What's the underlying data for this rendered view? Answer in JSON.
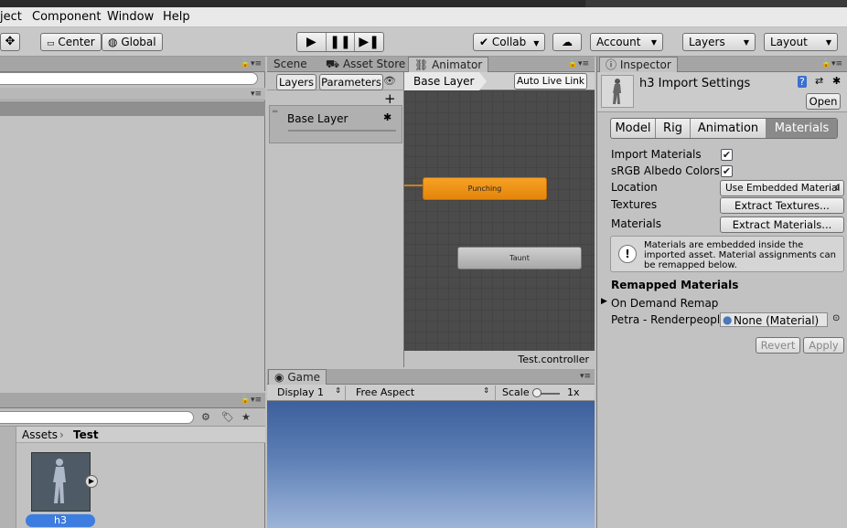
{
  "menu": [
    "ject",
    "Component",
    "Window",
    "Help"
  ],
  "toolbar": {
    "center": "Center",
    "global": "Global",
    "collab": "Collab",
    "account": "Account",
    "layers": "Layers",
    "layout": "Layout"
  },
  "tabs_center": [
    "Scene",
    "Asset Store",
    "Animator"
  ],
  "animator": {
    "sub_tabs": [
      "Layers",
      "Parameters"
    ],
    "breadcrumb": "Base Layer",
    "auto_live_link": "Auto Live Link",
    "layer_name": "Base Layer",
    "states": [
      "Punching",
      "Taunt"
    ],
    "controller": "Test.controller"
  },
  "game": {
    "tab": "Game",
    "display": "Display 1",
    "aspect": "Free Aspect",
    "scale_label": "Scale",
    "scale_value": "1x"
  },
  "project": {
    "path": [
      "Assets",
      "Test"
    ],
    "asset_name": "h3"
  },
  "inspector": {
    "tab": "Inspector",
    "title": "h3 Import Settings",
    "open": "Open",
    "tabs": [
      "Model",
      "Rig",
      "Animation",
      "Materials"
    ],
    "import_materials": "Import Materials",
    "srgb": "sRGB Albedo Colors",
    "location": "Location",
    "location_value": "Use Embedded Material",
    "textures": "Textures",
    "extract_textures": "Extract Textures...",
    "materials": "Materials",
    "extract_materials": "Extract Materials...",
    "info": "Materials are embedded inside the imported asset. Material assignments can be remapped below.",
    "remapped_header": "Remapped Materials",
    "on_demand": "On Demand Remap",
    "petra": "Petra - Renderpeople",
    "none_material": "None (Material)",
    "revert": "Revert",
    "apply": "Apply"
  }
}
